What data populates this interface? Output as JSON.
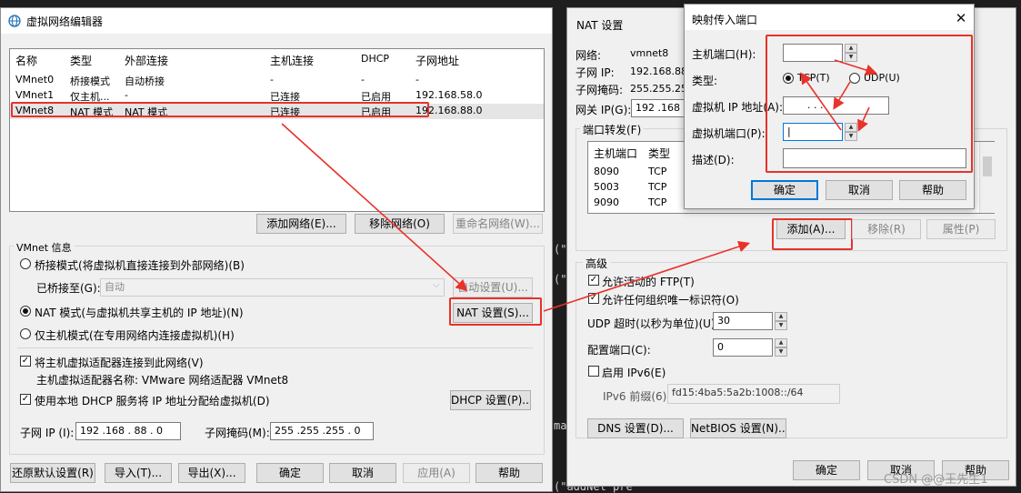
{
  "left": {
    "title": "虚拟网络编辑器",
    "columns": [
      "名称",
      "类型",
      "外部连接",
      "主机连接",
      "DHCP",
      "子网地址"
    ],
    "rows": [
      [
        "VMnet0",
        "桥接模式",
        "自动桥接",
        "-",
        "-",
        "-"
      ],
      [
        "VMnet1",
        "仅主机...",
        "-",
        "已连接",
        "已启用",
        "192.168.58.0"
      ],
      [
        "VMnet8",
        "NAT 模式",
        "NAT 模式",
        "已连接",
        "已启用",
        "192.168.88.0"
      ]
    ],
    "add_network": "添加网络(E)...",
    "remove_network": "移除网络(O)",
    "rename_network": "重命名网络(W)...",
    "info_label": "VMnet 信息",
    "bridge_mode": "桥接模式(将虚拟机直接连接到外部网络)(B)",
    "bridged_to": "已桥接至(G):",
    "bridged_value": "自动",
    "auto_settings": "自动设置(U)...",
    "nat_mode": "NAT 模式(与虚拟机共享主机的 IP 地址)(N)",
    "nat_settings": "NAT 设置(S)...",
    "host_only": "仅主机模式(在专用网络内连接虚拟机)(H)",
    "connect_adapter": "将主机虚拟适配器连接到此网络(V)",
    "adapter_name": "主机虚拟适配器名称: VMware 网络适配器 VMnet8",
    "use_dhcp": "使用本地 DHCP 服务将 IP 地址分配给虚拟机(D)",
    "dhcp_settings": "DHCP 设置(P)...",
    "subnet_ip_label": "子网 IP (I):",
    "subnet_ip": "192 .168 . 88  . 0",
    "subnet_mask_label": "子网掩码(M):",
    "subnet_mask": "255 .255 .255 . 0",
    "restore": "还原默认设置(R)",
    "import": "导入(T)...",
    "export": "导出(X)...",
    "ok": "确定",
    "cancel": "取消",
    "apply": "应用(A)",
    "help": "帮助"
  },
  "terminal": {
    "line1": "(\"",
    "line2": "(\"",
    "line3": "ma",
    "line4": "(\"addNet pre"
  },
  "nat": {
    "title": "NAT 设置",
    "network_label": "网络:",
    "network_value": "vmnet8",
    "subnet_ip_label": "子网 IP:",
    "subnet_ip_value": "192.168.88.",
    "subnet_mask_label": "子网掩码:",
    "subnet_mask_value": "255.255.255",
    "gateway_label": "网关 IP(G):",
    "gateway_value": "192 .168",
    "port_forward_label": "端口转发(F)",
    "pf_columns": [
      "主机端口",
      "类型"
    ],
    "pf_rows": [
      [
        "8090",
        "TCP"
      ],
      [
        "5003",
        "TCP"
      ],
      [
        "9090",
        "TCP"
      ]
    ],
    "add": "添加(A)...",
    "remove": "移除(R)",
    "properties": "属性(P)",
    "advanced": "高级",
    "allow_active_ftp": "允许活动的 FTP(T)",
    "allow_any_oui": "允许任何组织唯一标识符(O)",
    "udp_timeout_label": "UDP 超时(以秒为单位)(U):",
    "udp_timeout": "30",
    "config_port_label": "配置端口(C):",
    "config_port": "0",
    "enable_ipv6": "启用 IPv6(E)",
    "ipv6_prefix_label": "IPv6 前缀(6):",
    "ipv6_prefix": "fd15:4ba5:5a2b:1008::/64",
    "dns": "DNS 设置(D)...",
    "netbios": "NetBIOS 设置(N)...",
    "ok": "确定",
    "cancel": "取消",
    "help": "帮助",
    "watermark": "CSDN @@王先生1"
  },
  "map": {
    "title": "映射传入端口",
    "host_port_label": "主机端口(H):",
    "host_port": "",
    "type_label": "类型:",
    "tcp": "TCP(T)",
    "udp": "UDP(U)",
    "vm_ip_label": "虚拟机 IP 地址(A):",
    "vm_ip": ".     .     .",
    "vm_port_label": "虚拟机端口(P):",
    "vm_port": "|",
    "desc_label": "描述(D):",
    "desc": "",
    "ok": "确定",
    "cancel": "取消",
    "help": "帮助"
  },
  "colors": {
    "highlight": "#e8322a",
    "selection": "#0078d7"
  }
}
